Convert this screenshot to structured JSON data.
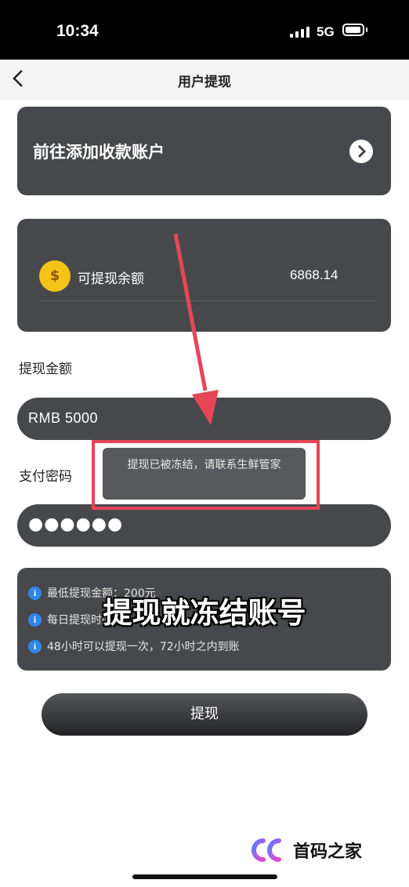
{
  "status_bar": {
    "time": "10:34",
    "network": "5G"
  },
  "nav": {
    "title": "用户提现",
    "back_icon": "chevron-left-icon"
  },
  "add_account": {
    "label": "前往添加收款账户",
    "icon": "chevron-right-circle-icon"
  },
  "balance": {
    "label": "可提现余额",
    "value": "6868.14",
    "icon": "money-bag-icon",
    "icon_glyph": "$"
  },
  "amount": {
    "label": "提现金额",
    "value": "RMB  5000"
  },
  "password": {
    "label": "支付密码",
    "masked_value": "●●●●●●"
  },
  "info": {
    "items": [
      "最低提现金额：200元",
      "每日提现时间",
      "48小时可以提现一次，72小时之内到账"
    ]
  },
  "submit_label": "提现",
  "toast": {
    "message": "提现已被冻结，请联系生鲜管家"
  },
  "annotation": {
    "caption": "提现就冻结账号",
    "highlight_color": "#e64656",
    "arrow_color": "#e64656"
  },
  "watermark": {
    "text": "首码之家"
  }
}
